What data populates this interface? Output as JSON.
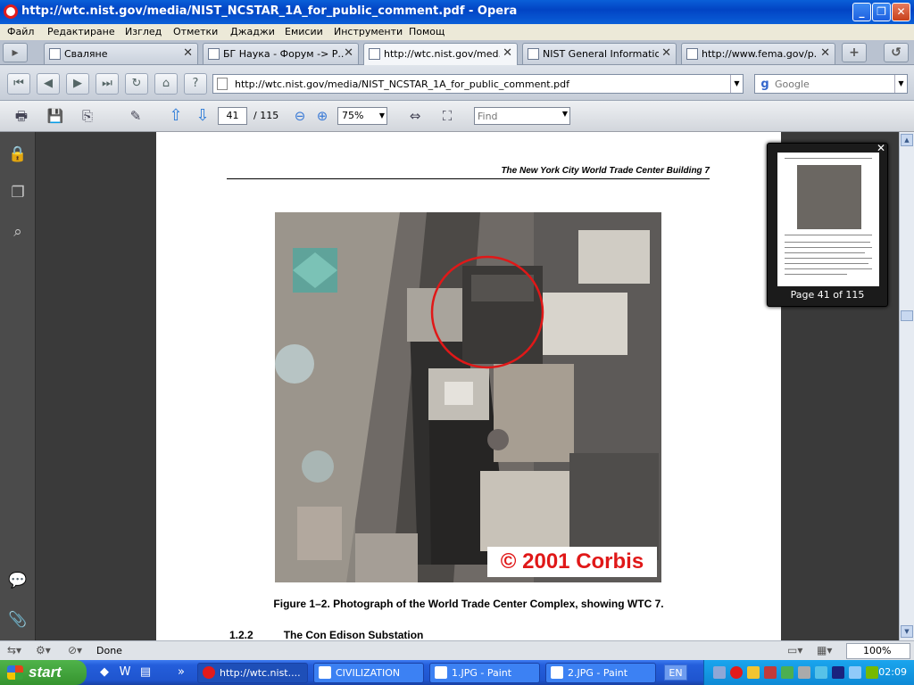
{
  "window": {
    "title": "http://wtc.nist.gov/media/NIST_NCSTAR_1A_for_public_comment.pdf - Opera"
  },
  "menu": [
    "Файл",
    "Редактиране",
    "Изглед",
    "Отметки",
    "Джаджи",
    "Емисии",
    "Инструменти",
    "Помощ"
  ],
  "tabs": [
    {
      "label": "Сваляне",
      "active": false
    },
    {
      "label": "БГ Наука - Форум -> Р...",
      "active": false
    },
    {
      "label": "http://wtc.nist.gov/med...",
      "active": true
    },
    {
      "label": "NIST General Information",
      "active": false
    },
    {
      "label": "http://www.fema.gov/p...",
      "active": false
    }
  ],
  "address": {
    "url": "http://wtc.nist.gov/media/NIST_NCSTAR_1A_for_public_comment.pdf",
    "search_placeholder": "Google"
  },
  "pdf_toolbar": {
    "page_current": "41",
    "page_total": "/ 115",
    "zoom": "75%",
    "find_placeholder": "Find"
  },
  "document": {
    "running_header": "The New York City World Trade Center Building 7",
    "photo_credit": "© 2001 Corbis",
    "figure_caption": "Figure 1–2.  Photograph of the World Trade Center Complex, showing WTC 7.",
    "section_number": "1.2.2",
    "section_title": "The Con Edison Substation"
  },
  "thumbnail": {
    "label": "Page 41 of 115"
  },
  "status": {
    "text": "Done",
    "zoom": "100%"
  },
  "taskbar": {
    "start": "start",
    "tasks": [
      {
        "label": "http://wtc.nist....",
        "active": true
      },
      {
        "label": "CIVILIZATION",
        "active": false
      },
      {
        "label": "1.JPG - Paint",
        "active": false
      },
      {
        "label": "2.JPG - Paint",
        "active": false
      }
    ],
    "language": "EN",
    "clock": "02:09"
  },
  "colors": {
    "accent_red": "#e01818",
    "viewer_bg": "#3a3a3a",
    "titlebar_blue": "#0244c4"
  }
}
